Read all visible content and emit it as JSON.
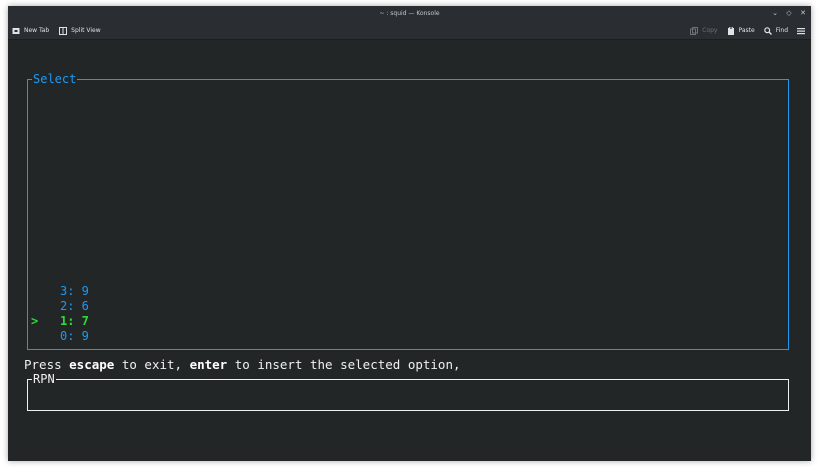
{
  "window": {
    "title": "~ : squid — Konsole"
  },
  "toolbar": {
    "new_tab": "New Tab",
    "split_view": "Split View",
    "copy": "Copy",
    "paste": "Paste",
    "find": "Find"
  },
  "terminal": {
    "select_title": "Select",
    "options": [
      {
        "label": "3: 9",
        "selected": false
      },
      {
        "label": "2: 6",
        "selected": false
      },
      {
        "label": "1: 7",
        "selected": true,
        "marker": ">"
      },
      {
        "label": "0: 9",
        "selected": false
      }
    ],
    "hint": {
      "press": "Press ",
      "escape": "escape",
      "to_exit": " to exit, ",
      "enter": "enter",
      "to_insert": " to insert the selected option,"
    },
    "rpn_title": "RPN"
  },
  "colors": {
    "accent": "#1d99f3",
    "selected": "#2edb3b",
    "background": "#232627",
    "foreground": "#eff0f1"
  }
}
